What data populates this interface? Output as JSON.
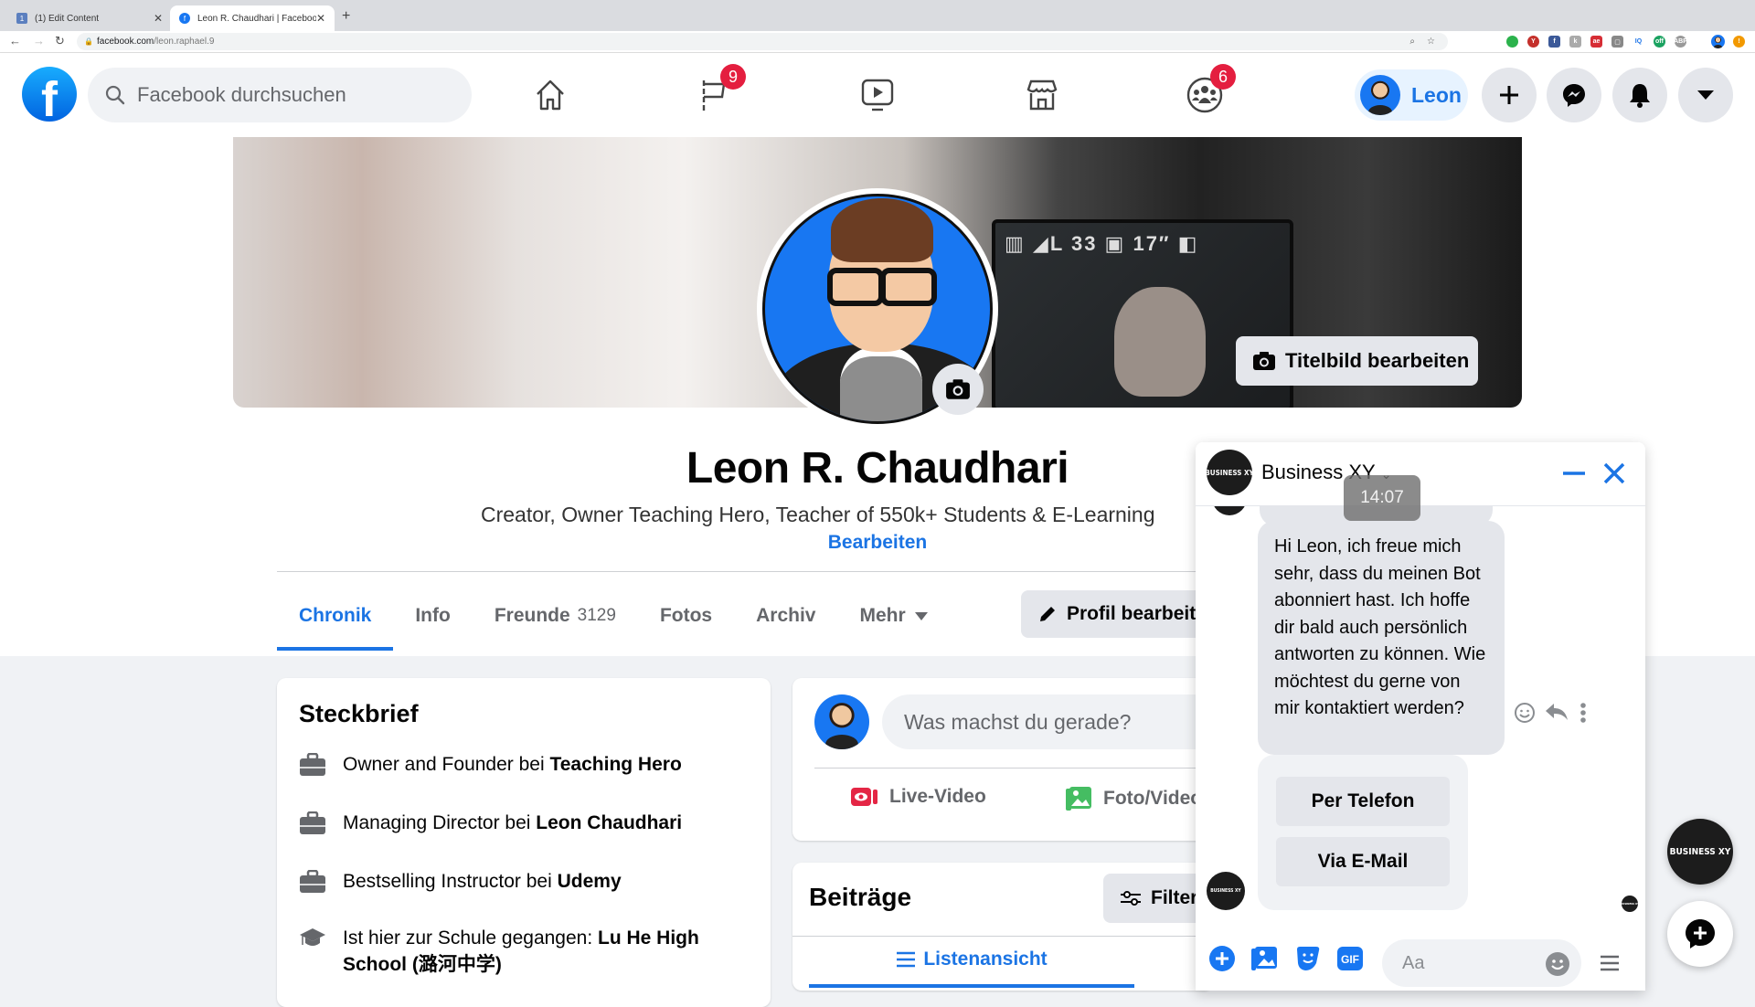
{
  "browser": {
    "tabs": [
      {
        "label": "(1) Edit Content",
        "active": false
      },
      {
        "label": "Leon R. Chaudhari | Facebook",
        "active": true
      }
    ],
    "url_host": "facebook.com",
    "url_path": "/leon.raphael.9",
    "extensions": [
      "zoom-icon",
      "star-icon",
      "green-ext",
      "yab-ext",
      "facebook-ext",
      "k-ext",
      "ae-ext",
      "screen-ext",
      "iq-ext",
      "off-ext",
      "abp-ext",
      "profile-avatar",
      "update-icon"
    ]
  },
  "header": {
    "search_placeholder": "Facebook durchsuchen",
    "nav": [
      {
        "name": "home",
        "badge": null
      },
      {
        "name": "pages",
        "badge": "9"
      },
      {
        "name": "watch",
        "badge": null
      },
      {
        "name": "marketplace",
        "badge": null
      },
      {
        "name": "groups",
        "badge": "6"
      }
    ],
    "user_name": "Leon",
    "accent": "#1b74e4",
    "badge_color": "#e41e3f"
  },
  "profile": {
    "cover_button": "Titelbild bearbeiten",
    "name": "Leon R. Chaudhari",
    "bio": "Creator, Owner Teaching Hero, Teacher of 550k+ Students & E-Learning",
    "edit_bio": "Bearbeiten",
    "tabs": [
      {
        "label": "Chronik",
        "active": true
      },
      {
        "label": "Info"
      },
      {
        "label": "Freunde",
        "count": "3129"
      },
      {
        "label": "Fotos"
      },
      {
        "label": "Archiv"
      },
      {
        "label": "Mehr"
      }
    ],
    "edit_profile": "Profil bearbeiten"
  },
  "intro": {
    "title": "Steckbrief",
    "items": [
      {
        "icon": "briefcase",
        "prefix": "Owner and Founder bei ",
        "bold": "Teaching Hero"
      },
      {
        "icon": "briefcase",
        "prefix": "Managing Director bei ",
        "bold": "Leon Chaudhari"
      },
      {
        "icon": "briefcase",
        "prefix": "Bestselling Instructor bei ",
        "bold": "Udemy"
      },
      {
        "icon": "graduation-cap",
        "prefix": "Ist hier zur Schule gegangen: ",
        "bold": "Lu He High School (潞河中学)"
      }
    ]
  },
  "composer": {
    "placeholder": "Was machst du gerade?",
    "live": "Live-Video",
    "photo": "Foto/Video"
  },
  "posts": {
    "title": "Beiträge",
    "filter": "Filter",
    "list_view": "Listenansicht"
  },
  "chat": {
    "name": "Business XY",
    "avatar_text": "BUSINESS XY",
    "timestamp": "14:07",
    "message": "Hi Leon, ich freue mich sehr, dass du meinen Bot abonniert hast. Ich hoffe dir bald auch persönlich antworten zu können. Wie möchtest du gerne von mir kontaktiert werden?",
    "quick_replies": [
      "Per Telefon",
      "Via E-Mail"
    ],
    "input_placeholder": "Aa"
  }
}
